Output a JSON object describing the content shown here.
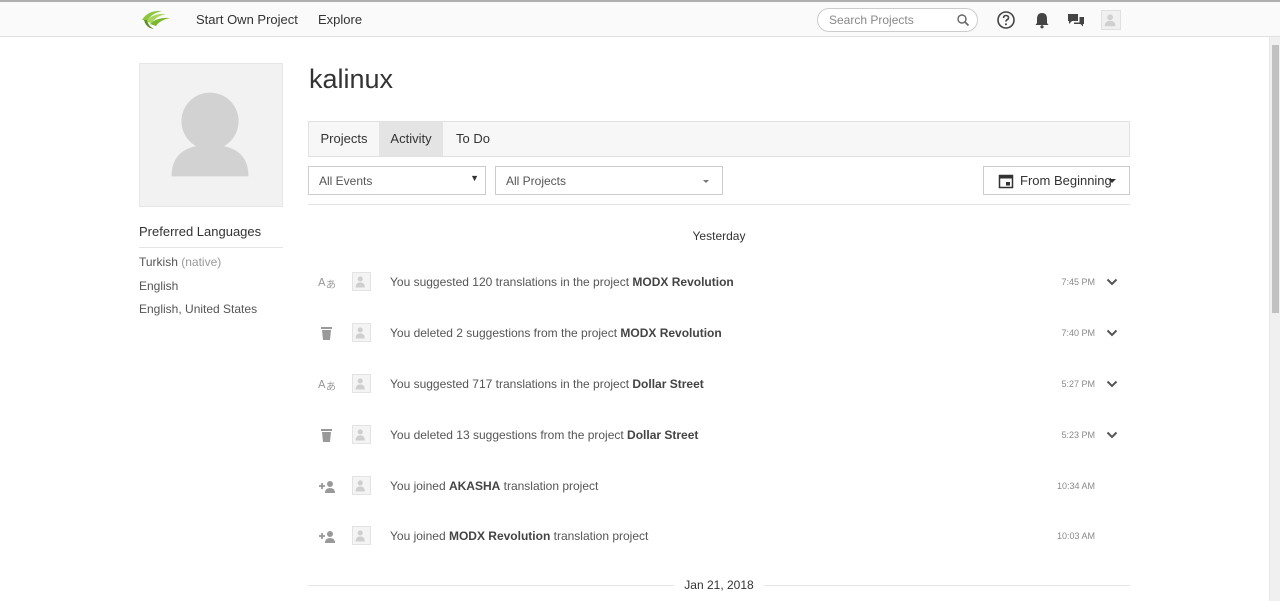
{
  "header": {
    "nav": [
      {
        "label": "Start Own Project"
      },
      {
        "label": "Explore"
      }
    ],
    "search": {
      "placeholder": "Search Projects"
    },
    "icons": [
      "logo-icon",
      "search-icon",
      "help-icon",
      "bell-icon",
      "chat-icon",
      "user-avatar"
    ]
  },
  "profile": {
    "username": "kalinux",
    "preferred_languages_title": "Preferred Languages",
    "languages": [
      {
        "name": "Turkish",
        "note": "(native)"
      },
      {
        "name": "English",
        "note": ""
      },
      {
        "name": "English, United States",
        "note": ""
      }
    ]
  },
  "tabs": [
    {
      "label": "Projects",
      "active": false
    },
    {
      "label": "Activity",
      "active": true
    },
    {
      "label": "To Do",
      "active": false
    }
  ],
  "filters": {
    "events_select": "All Events",
    "projects_select": "All Projects",
    "date_button": "From Beginning"
  },
  "activity": {
    "groups": [
      {
        "heading": "Yesterday",
        "items": [
          {
            "icon": "translate-icon",
            "prefix": "You suggested 120 translations in the project ",
            "project": "MODX Revolution",
            "suffix": "",
            "time": "7:45 PM",
            "expandable": true
          },
          {
            "icon": "trash-icon",
            "prefix": "You deleted 2 suggestions from the project ",
            "project": "MODX Revolution",
            "suffix": "",
            "time": "7:40 PM",
            "expandable": true
          },
          {
            "icon": "translate-icon",
            "prefix": "You suggested 717 translations in the project ",
            "project": "Dollar Street",
            "suffix": "",
            "time": "5:27 PM",
            "expandable": true
          },
          {
            "icon": "trash-icon",
            "prefix": "You deleted 13 suggestions from the project ",
            "project": "Dollar Street",
            "suffix": "",
            "time": "5:23 PM",
            "expandable": true
          },
          {
            "icon": "user-plus-icon",
            "prefix": "You joined ",
            "project": "AKASHA",
            "suffix": " translation project",
            "time": "10:34 AM",
            "expandable": false
          },
          {
            "icon": "user-plus-icon",
            "prefix": "You joined ",
            "project": "MODX Revolution",
            "suffix": " translation project",
            "time": "10:03 AM",
            "expandable": false
          }
        ]
      },
      {
        "heading": "Jan 21, 2018",
        "items": []
      }
    ]
  },
  "colors": {
    "logo_green": "#8cc63f",
    "tab_active_bg": "#e4e4e4",
    "border": "#cccccc"
  }
}
